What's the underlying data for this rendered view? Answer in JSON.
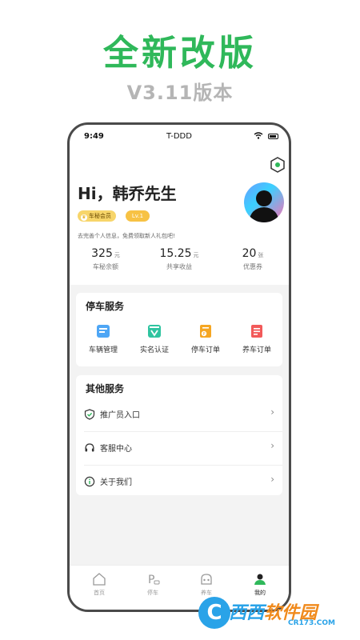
{
  "promo": {
    "headline": "全新改版",
    "version": "V3.11版本"
  },
  "status_bar": {
    "time": "9:49",
    "carrier": "T-DDD"
  },
  "profile": {
    "greeting": "Hi，韩乔先生",
    "member_badge": "车秘会员",
    "level_badge": "Lv.1",
    "hint": "去完善个人信息，免费领取新人礼包吧!"
  },
  "stats": [
    {
      "value": "325",
      "unit": "元",
      "label": "车秘余额"
    },
    {
      "value": "15.25",
      "unit": "元",
      "label": "共享收益"
    },
    {
      "value": "20",
      "unit": "张",
      "label": "优惠券"
    }
  ],
  "parking_services": {
    "title": "停车服务",
    "items": [
      {
        "label": "车辆管理",
        "icon": "vehicle-management-icon",
        "color": "#4ea6f5"
      },
      {
        "label": "实名认证",
        "icon": "real-name-verify-icon",
        "color": "#2fc4a0"
      },
      {
        "label": "停车订单",
        "icon": "parking-order-icon",
        "color": "#f5a623"
      },
      {
        "label": "养车订单",
        "icon": "car-care-order-icon",
        "color": "#f25a5a"
      }
    ]
  },
  "other_services": {
    "title": "其他服务",
    "items": [
      {
        "label": "推广员入口",
        "icon": "shield-icon"
      },
      {
        "label": "客服中心",
        "icon": "headset-icon"
      },
      {
        "label": "关于我们",
        "icon": "info-icon"
      }
    ]
  },
  "tabbar": {
    "items": [
      {
        "label": "首页",
        "icon": "home-icon"
      },
      {
        "label": "停车",
        "icon": "parking-icon"
      },
      {
        "label": "养车",
        "icon": "car-care-icon"
      },
      {
        "label": "我的",
        "icon": "user-icon",
        "active": true
      }
    ]
  },
  "watermark": {
    "logo_letter": "C",
    "text_a": "西西",
    "text_b": "软件园",
    "url": "CR173.COM"
  },
  "colors": {
    "brand_green": "#2fb85a",
    "badge_gold": "#f7c244",
    "watermark_blue": "#2aa3e8"
  }
}
